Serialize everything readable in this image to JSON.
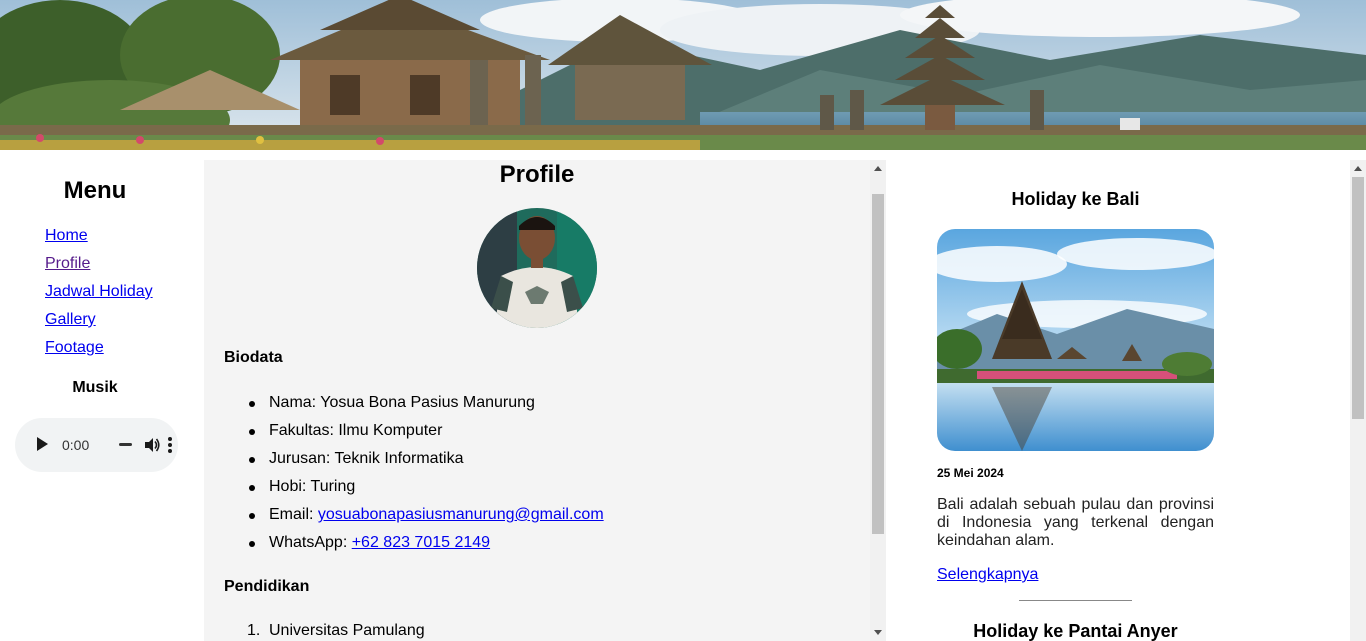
{
  "banner": {
    "image": "bali-temple-lake-banner"
  },
  "menu": {
    "title": "Menu",
    "items": [
      {
        "label": "Home",
        "visited": false
      },
      {
        "label": "Profile",
        "visited": true
      },
      {
        "label": "Jadwal Holiday",
        "visited": false
      },
      {
        "label": "Gallery",
        "visited": false
      },
      {
        "label": "Footage",
        "visited": false
      }
    ],
    "music_title": "Musik",
    "audio": {
      "time": "0:00"
    }
  },
  "profile": {
    "title": "Profile",
    "avatar": "profile-photo",
    "biodata_heading": "Biodata",
    "biodata": [
      {
        "label": "Nama: ",
        "value": "Yosua Bona Pasius Manurung"
      },
      {
        "label": "Fakultas: ",
        "value": "Ilmu Komputer"
      },
      {
        "label": "Jurusan: ",
        "value": "Teknik Informatika"
      },
      {
        "label": "Hobi: ",
        "value": "Turing"
      },
      {
        "label": "Email: ",
        "link": "yosuabonapasiusmanurung@gmail.com"
      },
      {
        "label": "WhatsApp: ",
        "link": "+62 823 7015 2149"
      }
    ],
    "pendidikan_heading": "Pendidikan",
    "pendidikan": [
      {
        "num": "1.",
        "value": "Universitas Pamulang"
      }
    ]
  },
  "holiday": {
    "cards": [
      {
        "title": "Holiday ke Bali",
        "image": "bali-ulun-danu-temple",
        "date": "25 Mei 2024",
        "text": "Bali adalah sebuah pulau dan provinsi di Indonesia yang terkenal dengan keindahan alam.",
        "link": "Selengkapnya"
      },
      {
        "title": "Holiday ke Pantai Anyer"
      }
    ]
  },
  "colors": {
    "link": "#0000ee",
    "visited": "#551a8b",
    "panel": "#f4f4f4"
  }
}
